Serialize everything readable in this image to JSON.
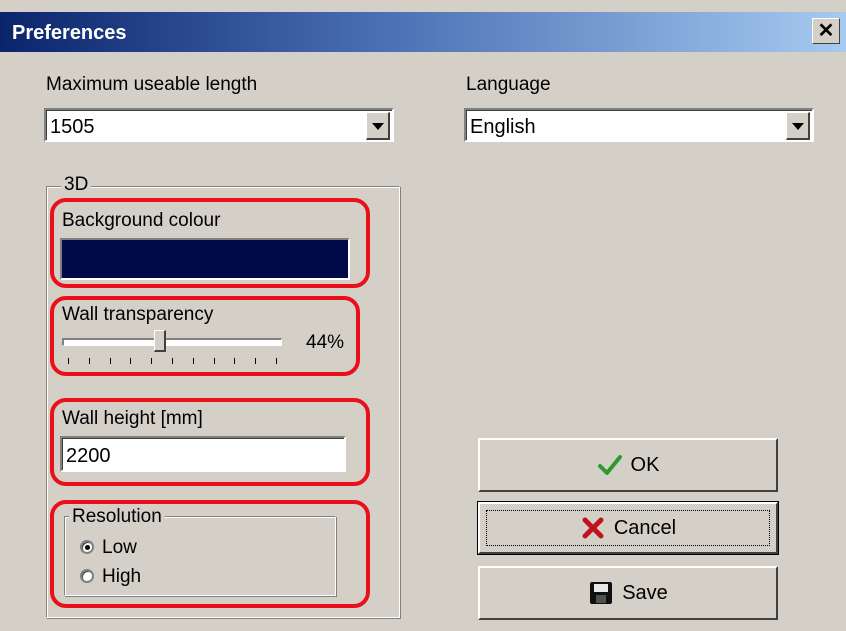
{
  "window": {
    "title": "Preferences"
  },
  "max_length": {
    "label": "Maximum useable length",
    "value": "1505"
  },
  "language": {
    "label": "Language",
    "value": "English"
  },
  "group_3d": {
    "title": "3D",
    "background_colour": {
      "label": "Background colour",
      "color": "#000a4a"
    },
    "wall_transparency": {
      "label": "Wall transparency",
      "value_text": "44%",
      "value": 44
    },
    "wall_height": {
      "label": "Wall height [mm]",
      "value": "2200"
    },
    "resolution": {
      "title": "Resolution",
      "options": [
        {
          "label": "Low",
          "checked": true
        },
        {
          "label": "High",
          "checked": false
        }
      ]
    }
  },
  "buttons": {
    "ok": {
      "label": "OK",
      "icon": "checkmark-icon"
    },
    "cancel": {
      "label": "Cancel",
      "icon": "cross-icon"
    },
    "save": {
      "label": "Save",
      "icon": "floppy-disk-icon"
    }
  },
  "highlight_color": "#e8101a"
}
